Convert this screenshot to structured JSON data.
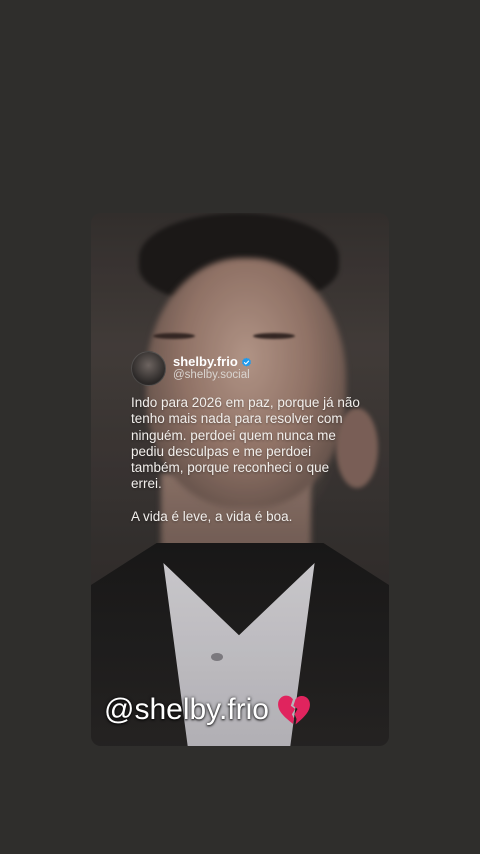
{
  "tweet": {
    "display_name": "shelby.frio",
    "handle": "@shelby.social",
    "verified": true,
    "paragraph_1": "Indo para 2026 em paz, porque já não tenho mais nada para resolver com ninguém. perdoei quem nunca me pediu desculpas e me perdoei também, porque reconheci o que errei.",
    "paragraph_2": "A vida é leve, a vida é boa."
  },
  "watermark": {
    "text": "@shelby.frio",
    "icon": "broken-heart-icon"
  },
  "colors": {
    "page_background": "#2f2e2c",
    "verified_badge": "#1d9bf0",
    "heart": "#e0245e"
  }
}
